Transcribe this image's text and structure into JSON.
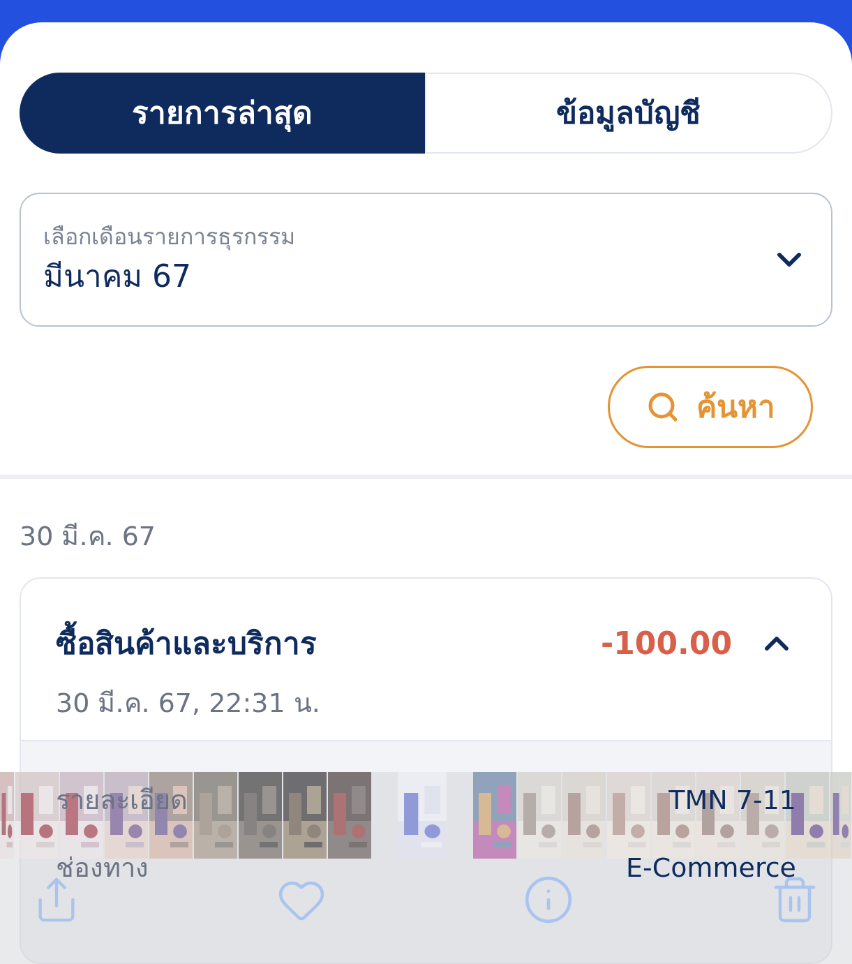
{
  "tabs": [
    {
      "label": "รายการล่าสุด",
      "selected": true
    },
    {
      "label": "ข้อมูลบัญชี",
      "selected": false
    }
  ],
  "month_select": {
    "label": "เลือกเดือนรายการธุรกรรม",
    "value": "มีนาคม 67"
  },
  "search_button": {
    "label": "ค้นหา"
  },
  "date_heading": "30 มี.ค. 67",
  "transactions": [
    {
      "title": "ซื้อสินค้าและบริการ",
      "amount": "-100.00",
      "datetime": "30 มี.ค. 67, 22:31 น.",
      "expanded": true,
      "details": [
        {
          "label": "รายละเอียด",
          "value": "TMN 7-11"
        },
        {
          "label": "ช่องทาง",
          "value": "E-Commerce"
        }
      ]
    }
  ]
}
